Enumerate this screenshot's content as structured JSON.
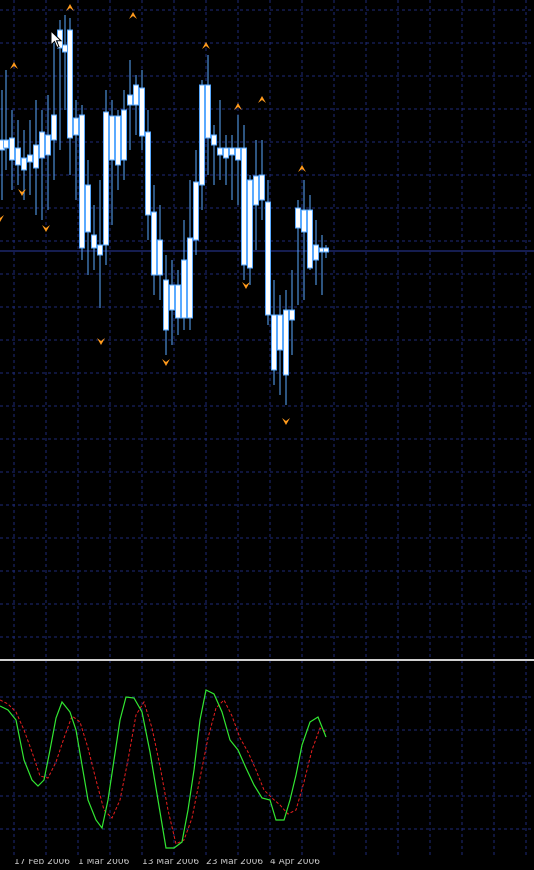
{
  "window": {
    "title": ""
  },
  "colors": {
    "background": "#000000",
    "grid": "#1e2a78",
    "bull_candle": "#ffffff",
    "candle_outline": "#5aaaff",
    "fractal_marker": "#ff9a1c",
    "indicator_main": "#32e632",
    "indicator_signal": "#e61e1e",
    "separator": "#d0d0d0",
    "axis_text": "#c8c8c8"
  },
  "icons": {
    "cursor": "mouse-pointer-icon",
    "fractal_up": "fractal-up-arrow-icon",
    "fractal_down": "fractal-down-arrow-icon"
  },
  "date_axis": {
    "labels": [
      "17 Feb 2006",
      "1 Mar 2006",
      "13 Mar 2006",
      "23 Mar 2006",
      "4 Apr 2006"
    ]
  },
  "chart_data": [
    {
      "type": "candlestick",
      "title": "",
      "fractals_up_bars": [
        1,
        7,
        14,
        23,
        27,
        29,
        35
      ],
      "fractals_down_bars": [
        0,
        2,
        5,
        11,
        19,
        27,
        34
      ]
    },
    {
      "type": "line",
      "title": "",
      "series": [
        {
          "name": "",
          "values": []
        },
        {
          "name": "",
          "values": []
        }
      ]
    }
  ]
}
